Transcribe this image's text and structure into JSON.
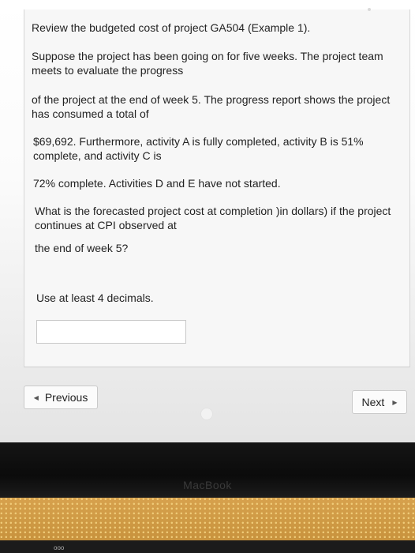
{
  "question": {
    "line1": "Review the budgeted cost of project GA504 (Example 1).",
    "para1_line1": "Suppose the project has been going on for five weeks. The project team",
    "para1_line2": "meets to evaluate the progress",
    "para2_line1": "of the project at the end of week 5. The progress report shows the project",
    "para2_line2": "has consumed a total of",
    "para3_line1": "$69,692. Furthermore, activity A is fully completed, activity B is 51%",
    "para3_line2": "complete, and activity C is",
    "para4": "72% complete. Activities D and E have not started.",
    "para5_line1": "What is the forecasted project cost at completion )in dollars) if the project",
    "para5_line2": "continues at CPI observed at",
    "para6": "the end of week 5?",
    "instruction": "Use at least 4 decimals."
  },
  "answer": {
    "value": ""
  },
  "navigation": {
    "previous_label": "Previous",
    "next_label": "Next"
  },
  "hardware": {
    "brand": "MacBook",
    "key_label": "ooo"
  }
}
